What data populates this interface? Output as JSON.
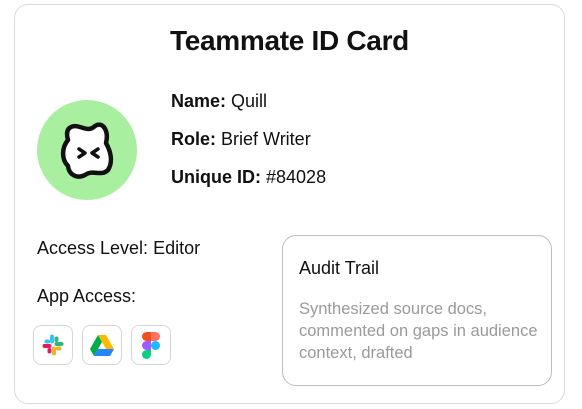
{
  "card": {
    "title": "Teammate ID Card",
    "avatar_color": "#a8ef9f",
    "avatar_icon": "winking-face-icon",
    "fields": {
      "name_label": "Name:",
      "name_value": "Quill",
      "role_label": "Role:",
      "role_value": "Brief Writer",
      "uid_label": "Unique ID:",
      "uid_value": "#84028"
    },
    "access": {
      "level_label": "Access Level:",
      "level_value": "Editor",
      "apps_label": "App Access:",
      "apps": [
        {
          "name": "slack",
          "icon": "slack-icon"
        },
        {
          "name": "google-drive",
          "icon": "google-drive-icon"
        },
        {
          "name": "figma",
          "icon": "figma-icon"
        }
      ]
    },
    "audit": {
      "title": "Audit Trail",
      "body": "Synthesized source docs, commented on gaps in audience context, drafted"
    }
  }
}
